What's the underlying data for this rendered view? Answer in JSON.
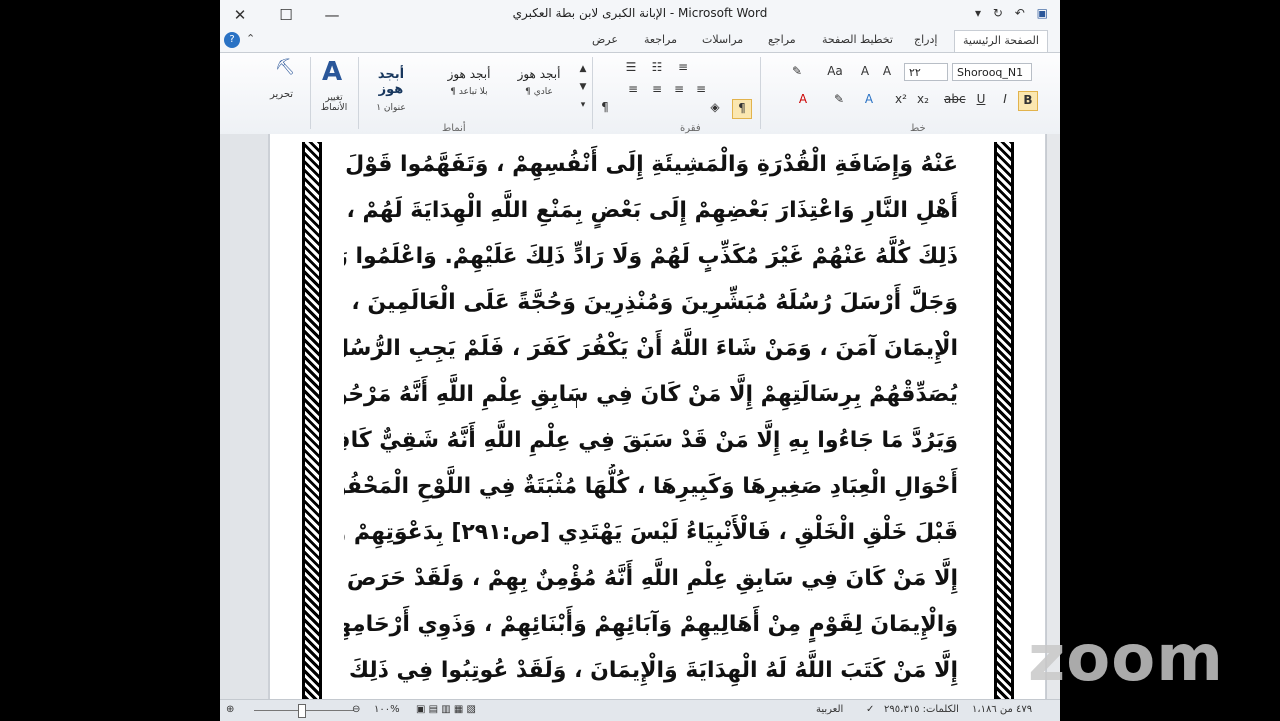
{
  "window": {
    "title": "الإبانة الكبرى لابن بطة العكبري  -  Microsoft Word",
    "controls": [
      "✕",
      "☐",
      "—"
    ],
    "quick_access": [
      "▾",
      "↻",
      "↶",
      "▣"
    ]
  },
  "tabs": [
    "الصفحة الرئيسية",
    "إدراج",
    "تخطيط الصفحة",
    "مراجع",
    "مراسلات",
    "مراجعة",
    "عرض"
  ],
  "ribbon": {
    "font_name": "Shorooq_N1",
    "font_size": "٢٢",
    "groups": {
      "font": "خط",
      "paragraph": "فقرة",
      "styles": "أنماط",
      "editing": "تحرير"
    },
    "styles": [
      {
        "sample": "أبجد هوز",
        "name": "¶ عادي"
      },
      {
        "sample": "أبجد هوز",
        "name": "¶ بلا تباعد"
      },
      {
        "sample": "أبجد هوز",
        "name": "عنوان ١"
      }
    ],
    "change_styles": "تغيير الأنماط",
    "edit_label": "تحرير"
  },
  "document": {
    "lines": [
      "عَنْهُ وَإِضَافَةِ الْقُدْرَةِ وَالْمَشِيئَةِ إِلَى أَنْفُسِهِمْ ، وَتَفَهَّمُوا قَوْلَ الْأَنْبِيَاءِ لِقَوْمِهِمْ وَكَلَامَ",
      "أَهْلِ النَّارِ وَاعْتِذَارَ بَعْضِهِمْ إِلَى بَعْضٍ بِمَنْعِ اللَّهِ الْهِدَايَةَ لَهُمْ ، وَاللَّهُ عَزَّ وَجَلَّ يَحْكِي",
      "ذَلِكَ كُلَّهُ عَنْهُمْ غَيْرَ مُكَذِّبٍ لَهُمْ وَلَا رَادٍّ ذَلِكَ عَلَيْهِمْ. وَاعْلَمُوا رَحِمَكُمُ اللَّهُ أَنَّ اللَّهَ عَزَّ",
      "وَجَلَّ أَرْسَلَ رُسُلَهُ مُبَشِّرِينَ وَمُنْذِرِينَ وَحُجَّةً عَلَى الْعَالَمِينَ ، فَمَنْ شَاءَ اللَّهُ تَعَالَى لَهُ",
      "الْإِيمَانَ آمَنَ ، وَمَنْ شَاءَ اللَّهُ أَنْ يَكْفُرَ كَفَرَ ، فَلَمْ يَجِبِ الرُّسُلَ إِلَى دَعْوَتِهِمْ وَلَمْ",
      "يُصَدِّقْهُمْ بِرِسَالَتِهِمْ إِلَّا مَنْ كَانَ فِي سَابِقِ عِلْمِ اللَّهِ أَنَّهُ مَرْحُومٌ مُؤْمِنٌ ، وَلَمْ يُكَذِّبْهُمْ",
      "وَيَرُدَّ مَا جَاءُوا بِهِ إِلَّا مَنْ قَدْ سَبَقَ فِي عِلْمِ اللَّهِ أَنَّهُ شَقِيٌّ كَافِرٌ ، وَعَلَى ذَلِكَ جَمِيعُ",
      "أَحْوَالِ الْعِبَادِ صَغِيرِهَا وَكَبِيرِهَا ، كُلُّهَا مُثْبَتَةٌ فِي اللَّوْحِ الْمَحْفُوظِ وَالرَّقِّ الْمَنْشُورِ",
      "قَبْلَ خَلْقِ الْخَلْقِ ، فَالْأَنْبِيَاءُ لَيْسَ يَهْتَدِي [ص:٢٩١] بِدَعْوَتِهِمْ وَلَا يُؤْمِنُ بِرِسَالَتِهِمْ",
      "إِلَّا مَنْ كَانَ فِي سَابِقِ عِلْمِ اللَّهِ أَنَّهُ مُؤْمِنٌ بِهِمْ ، وَلَقَدْ حَرَصَ الْأَنْبِيَاءُ وَأَحَبُّوا الْهِدَايَةَ",
      "وَالْإِيمَانَ لِقَوْمٍ مِنْ أَهَالِيهِمْ وَآبَائِهِمْ وَأَبْنَائِهِمْ ، وَذَوِي أَرْحَامِهِمْ ، فَمَا اهْتَدَى مِنْهُمْ",
      "إِلَّا مَنْ كَتَبَ اللَّهُ لَهُ الْهِدَايَةَ وَالْإِيمَانَ ، وَلَقَدْ عُوتِبُوا فِي ذَلِكَ بِأَشَدِّ الْعَتْبِ ، وَحَسْبُكَ"
    ]
  },
  "status": {
    "page": "٤٧٩ من ١،١٨٦",
    "words": "الكلمات: ٢٩٥،٣١٥",
    "language": "العربية",
    "zoom": "١٠٠%"
  },
  "overlay": {
    "logo": "zoom"
  }
}
